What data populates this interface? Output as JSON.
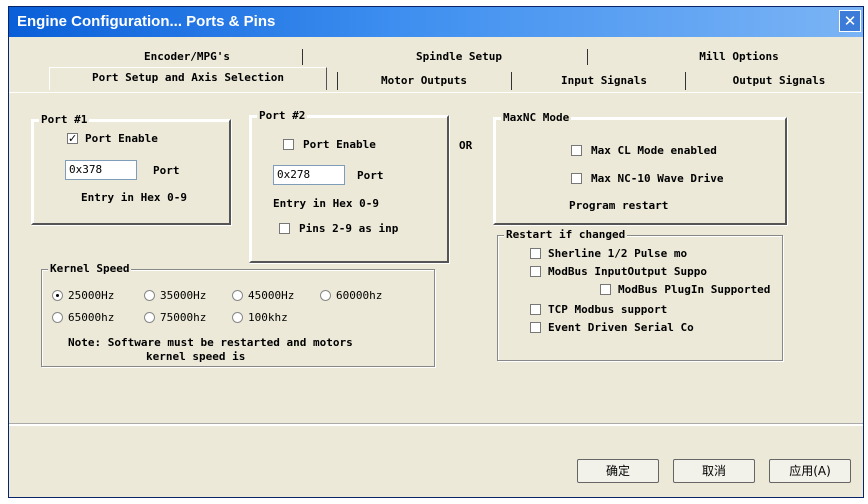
{
  "window": {
    "title": "Engine Configuration... Ports & Pins",
    "close_glyph": "✕"
  },
  "tabs": {
    "row1": [
      "Encoder/MPG's",
      "Spindle Setup",
      "Mill Options"
    ],
    "row2": [
      "Port Setup and Axis Selection",
      "Motor Outputs",
      "Input Signals",
      "Output Signals"
    ],
    "selected": "Port Setup and Axis Selection"
  },
  "port1": {
    "title": "Port #1",
    "enable_label": "Port Enable",
    "enable_checked": true,
    "address_value": "0x378",
    "address_label": "Port",
    "hint": "Entry in Hex 0-9"
  },
  "port2": {
    "title": "Port #2",
    "enable_label": "Port Enable",
    "enable_checked": false,
    "address_value": "0x278",
    "address_label": "Port",
    "hint": "Entry in Hex 0-9",
    "pins_label": "Pins 2-9 as inp",
    "pins_checked": false
  },
  "or_label": "OR",
  "maxnc": {
    "title": "MaxNC Mode",
    "cl_label": "Max CL Mode enabled",
    "wave_label": "Max NC-10 Wave Drive",
    "restart_note": "Program restart"
  },
  "restart": {
    "title": "Restart if changed",
    "sherline_label": "Sherline 1/2 Pulse mo",
    "modbus_io_label": "ModBus InputOutput Suppo",
    "modbus_plugin_label": "ModBus PlugIn Supported",
    "tcp_label": "TCP Modbus support",
    "serial_label": "Event Driven Serial Co"
  },
  "kernel": {
    "title": "Kernel Speed",
    "options": [
      "25000Hz",
      "35000Hz",
      "45000Hz",
      "60000hz",
      "65000hz",
      "75000hz",
      "100khz"
    ],
    "selected": "25000Hz",
    "note1": "Note: Software must be restarted and motors",
    "note2": "kernel speed is"
  },
  "buttons": {
    "ok": "确定",
    "cancel": "取消",
    "apply": "应用(A)"
  }
}
